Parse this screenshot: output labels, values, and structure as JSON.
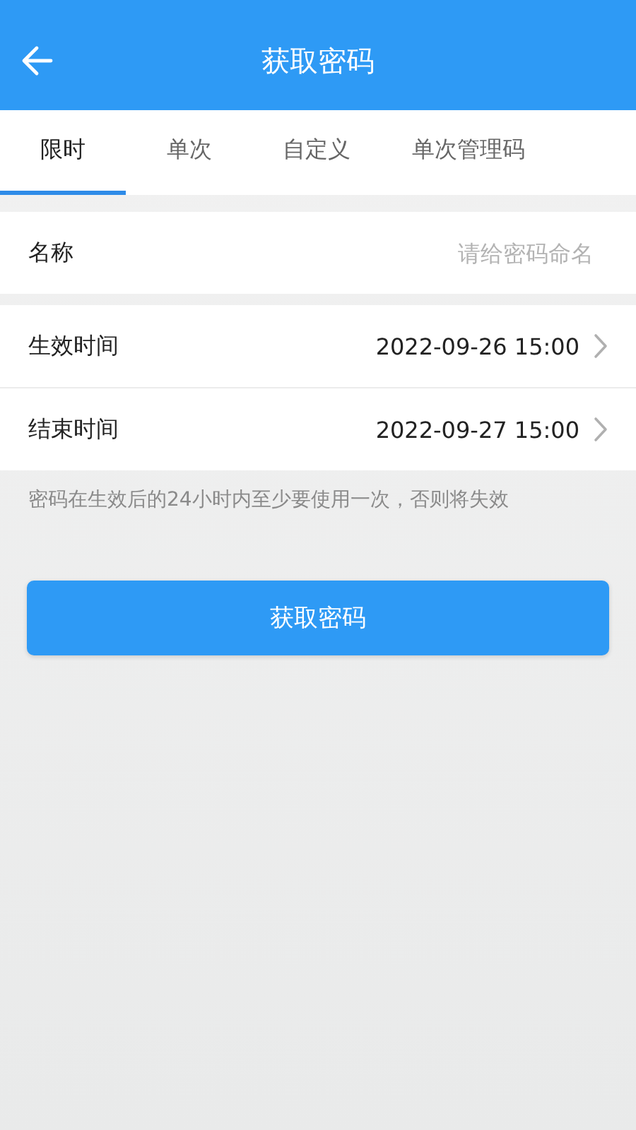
{
  "header": {
    "title": "获取密码"
  },
  "tabs": [
    {
      "label": "限时",
      "selected": true
    },
    {
      "label": "单次",
      "selected": false
    },
    {
      "label": "自定义",
      "selected": false
    },
    {
      "label": "单次管理码",
      "selected": false
    }
  ],
  "name_field": {
    "label": "名称",
    "placeholder": "请给密码命名"
  },
  "time_rows": [
    {
      "label": "生效时间",
      "value": "2022-09-26 15:00"
    },
    {
      "label": "结束时间",
      "value": "2022-09-27 15:00"
    }
  ],
  "note": "密码在生效后的24小时内至少要使用一次，否则将失效",
  "submit_button": "获取密码"
}
